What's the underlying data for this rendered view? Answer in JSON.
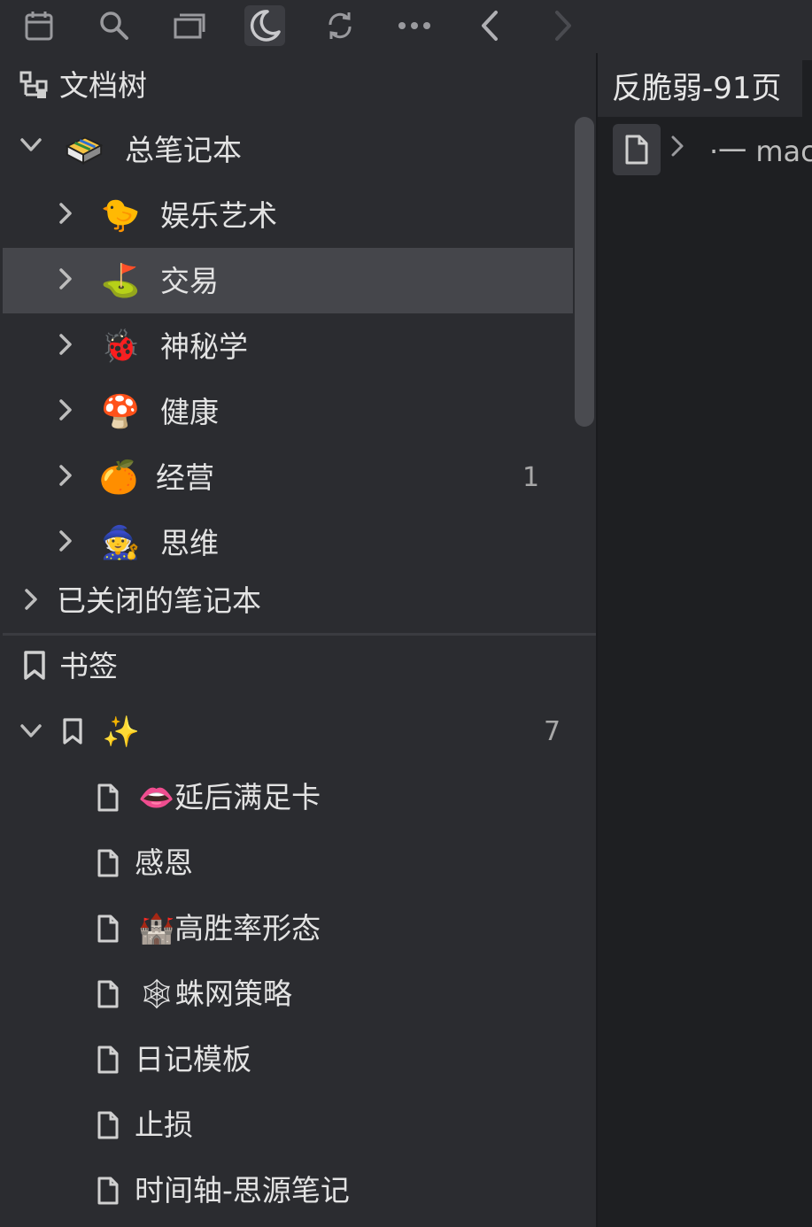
{
  "toolbar": {
    "icons": [
      "calendar-icon",
      "search-icon",
      "windows-icon",
      "moon-icon",
      "sync-icon",
      "more-icon",
      "back-icon",
      "forward-icon"
    ]
  },
  "sidebar": {
    "doctree_title": "文档树",
    "notebook": {
      "name": "总笔记本",
      "items": [
        {
          "label": "娱乐艺术",
          "emoji": "🐤"
        },
        {
          "label": "交易",
          "emoji": "⛳"
        },
        {
          "label": "神秘学",
          "emoji": "🐞"
        },
        {
          "label": "健康",
          "emoji": "🍄"
        },
        {
          "label": "经营",
          "emoji": "🍊",
          "count": "1"
        },
        {
          "label": "思维",
          "emoji": "🧙"
        }
      ]
    },
    "closed_notebooks": "已关闭的笔记本",
    "bookmarks": {
      "title": "书签",
      "group_emoji": "✨",
      "group_count": "7",
      "items": [
        {
          "emoji": "👄",
          "label": "延后满足卡"
        },
        {
          "emoji": "",
          "label": "感恩"
        },
        {
          "emoji": "🏰",
          "label": "高胜率形态"
        },
        {
          "emoji": "🕸",
          "label": "蛛网策略"
        },
        {
          "emoji": "",
          "label": "日记模板"
        },
        {
          "emoji": "",
          "label": "止损"
        },
        {
          "emoji": "",
          "label": "时间轴-思源笔记"
        }
      ]
    }
  },
  "editor": {
    "tab_title": "反脆弱-91页",
    "breadcrumb_text": "·一 mac"
  },
  "colors": {
    "background": "#1e1f22",
    "panel": "#2b2c30",
    "selected_row": "#45464b",
    "text": "#e3e3e3",
    "muted": "#a8a8a8"
  }
}
